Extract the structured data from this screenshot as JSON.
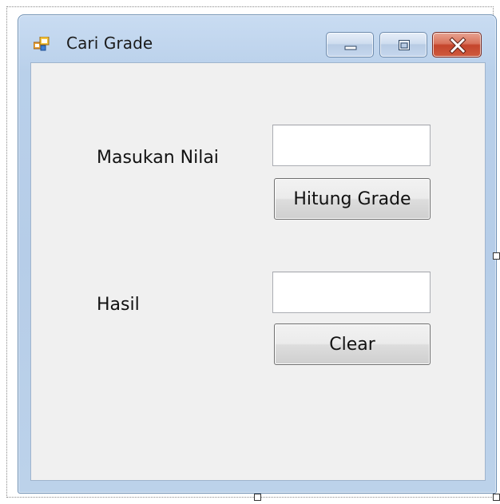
{
  "window": {
    "title": "Cari Grade",
    "icon": "form-app-icon",
    "caption_buttons": [
      "minimize",
      "maximize",
      "close"
    ]
  },
  "form": {
    "nilai_label": "Masukan Nilai",
    "nilai_value": "",
    "hitung_button": "Hitung Grade",
    "hasil_label": "Hasil",
    "hasil_value": "",
    "clear_button": "Clear"
  },
  "designer": {
    "resize_handles": [
      "right",
      "bottom",
      "bottom-right"
    ]
  },
  "colors": {
    "frame": "#b9d0ea",
    "client": "#f0f0f0",
    "close_button": "#c4452c"
  }
}
